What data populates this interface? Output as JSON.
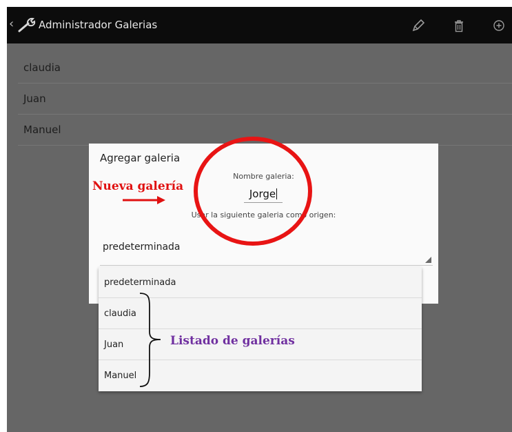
{
  "action_bar": {
    "back_glyph": "‹",
    "app_icon": "wrench-icon",
    "title": "Administrador Galerias",
    "edit_icon": "pencil-icon",
    "delete_icon": "trash-icon",
    "add_icon": "add-circle-icon"
  },
  "gallery_list": {
    "items": [
      "claudia",
      "Juan",
      "Manuel"
    ]
  },
  "dialog": {
    "title": "Agregar galeria",
    "name_label": "Nombre galeria:",
    "name_value": "Jorge",
    "origin_label": "Usar la siguiente galeria como origen:",
    "spinner_selected": "predeterminada"
  },
  "dropdown": {
    "options": [
      "predeterminada",
      "claudia",
      "Juan",
      "Manuel"
    ]
  },
  "annotations": {
    "new_gallery": "Nueva galería",
    "gallery_list": "Listado de galerías",
    "red_color": "#e01010",
    "purple_color": "#7030a0"
  }
}
